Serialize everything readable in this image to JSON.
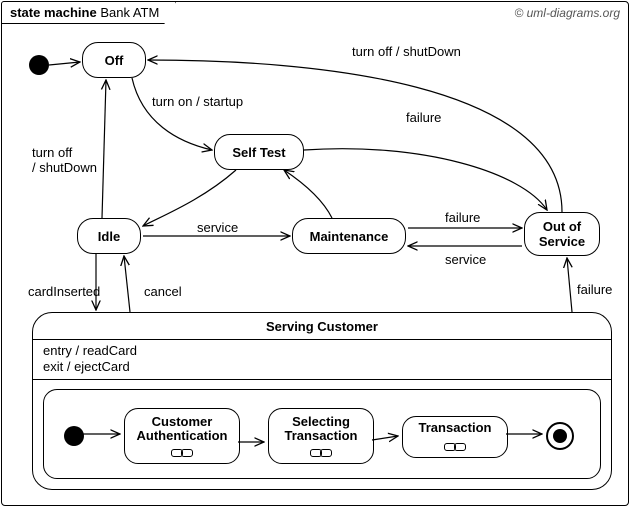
{
  "diagram": {
    "kind_label": "state machine",
    "name": "Bank ATM",
    "copyright": "© uml-diagrams.org",
    "states": {
      "off": "Off",
      "self_test": "Self Test",
      "idle": "Idle",
      "maintenance": "Maintenance",
      "out_of_service": "Out of\nService",
      "serving_customer": "Serving Customer",
      "cust_auth": "Customer\nAuthentication",
      "selecting": "Selecting\nTransaction",
      "transaction": "Transaction"
    },
    "serving_entry": "entry / readCard",
    "serving_exit": "exit / ejectCard",
    "transitions": {
      "turn_off_shutdown_top": "turn off / shutDown",
      "turn_on_startup": "turn on / startup",
      "failure_selftest": "failure",
      "turn_off_shutdown_left": "turn off\n/ shutDown",
      "service_idle": "service",
      "failure_maint": "failure",
      "service_back": "service",
      "card_inserted": "cardInserted",
      "cancel": "cancel",
      "failure_serving": "failure"
    }
  }
}
